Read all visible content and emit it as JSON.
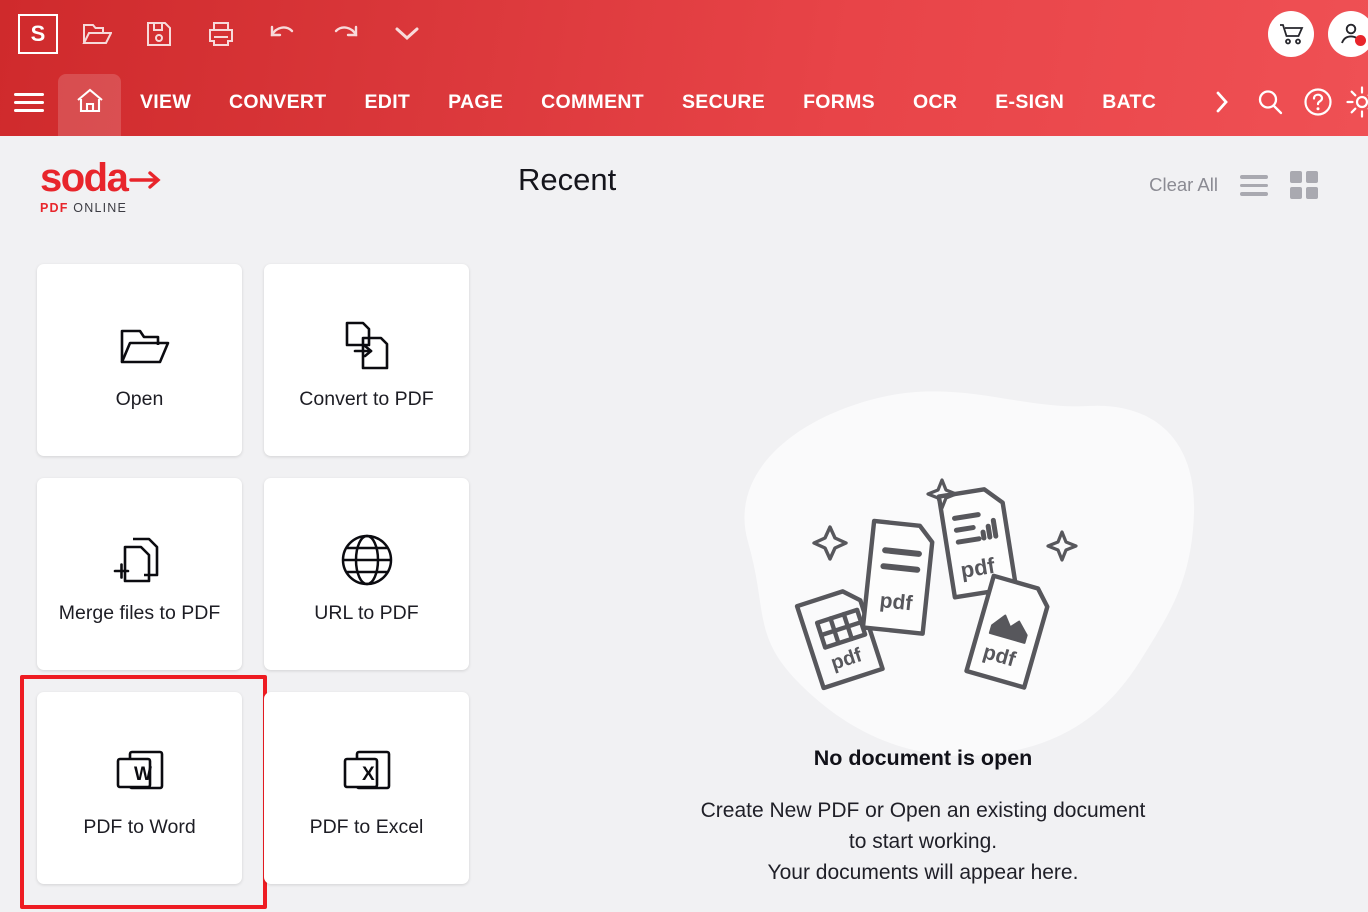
{
  "colors": {
    "brand_red": "#e8252b",
    "header_red_left": "#cf2a2c",
    "header_red_right": "#ef5054",
    "annotation_red": "#ee1c22",
    "page_bg": "#f1f1f3",
    "tile_bg": "#ffffff",
    "illustration_gray": "#57575c"
  },
  "header": {
    "app_initial": "S",
    "quick_access": [
      {
        "name": "open-icon",
        "label": "Open"
      },
      {
        "name": "save-icon",
        "label": "Save"
      },
      {
        "name": "print-icon",
        "label": "Print"
      },
      {
        "name": "undo-icon",
        "label": "Undo"
      },
      {
        "name": "redo-icon",
        "label": "Redo"
      },
      {
        "name": "chevron-down-icon",
        "label": "More"
      }
    ],
    "cart_label": "Cart",
    "account_label": "Account",
    "account_has_notification": true,
    "tabs": [
      {
        "label": "VIEW"
      },
      {
        "label": "CONVERT"
      },
      {
        "label": "EDIT"
      },
      {
        "label": "PAGE"
      },
      {
        "label": "COMMENT"
      },
      {
        "label": "SECURE"
      },
      {
        "label": "FORMS"
      },
      {
        "label": "OCR"
      },
      {
        "label": "E-SIGN"
      },
      {
        "label": "BATC"
      }
    ],
    "home_tab_active": true,
    "overflow_label": "More tabs",
    "right_tools": [
      {
        "name": "search-icon",
        "label": "Search"
      },
      {
        "name": "help-icon",
        "label": "Help"
      },
      {
        "name": "gear-icon",
        "label": "Settings"
      }
    ]
  },
  "brand": {
    "name": "soda",
    "sub_pdf": "PDF",
    "sub_online": "ONLINE"
  },
  "recent": {
    "title": "Recent",
    "clear_all": "Clear All",
    "view_list_label": "List view",
    "view_grid_label": "Grid view"
  },
  "tiles": [
    {
      "label": "Open",
      "icon": "folder-open-icon",
      "highlighted": false
    },
    {
      "label": "Convert to PDF",
      "icon": "convert-to-pdf-icon",
      "highlighted": false
    },
    {
      "label": "Merge files to PDF",
      "icon": "merge-files-icon",
      "highlighted": false
    },
    {
      "label": "URL to PDF",
      "icon": "globe-icon",
      "highlighted": false
    },
    {
      "label": "PDF to Word",
      "icon": "word-doc-icon",
      "highlighted": true
    },
    {
      "label": "PDF to Excel",
      "icon": "excel-doc-icon",
      "highlighted": false
    }
  ],
  "empty_state": {
    "title": "No document is open",
    "line1": "Create New PDF or Open an existing document",
    "line2": "to start working.",
    "line3": "Your documents will appear here.",
    "illustration_labels": [
      "pdf",
      "pdf",
      "pdf",
      "pdf"
    ]
  }
}
